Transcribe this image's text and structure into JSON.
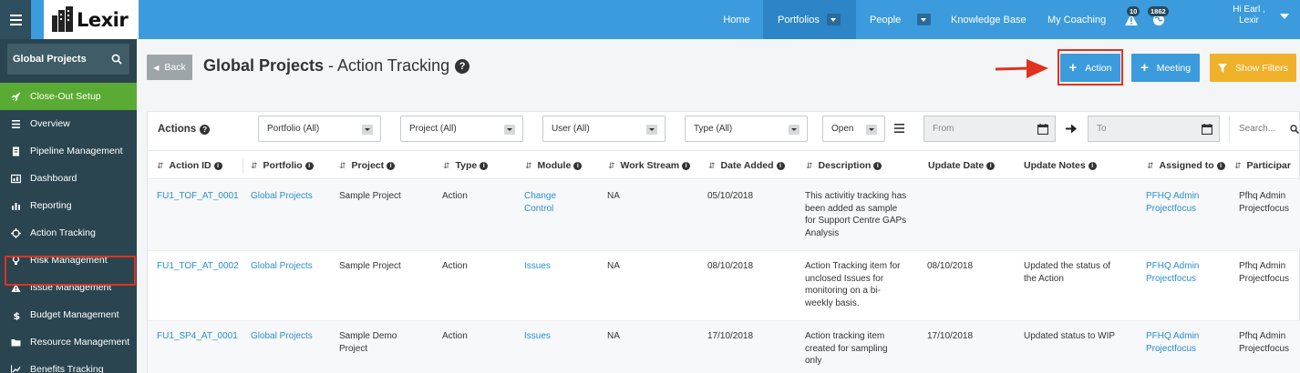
{
  "topnav": {
    "logo_text": "Lexir",
    "items": [
      {
        "label": "Home"
      },
      {
        "label": "Portfolios"
      },
      {
        "label": "People"
      },
      {
        "label": "Knowledge Base"
      },
      {
        "label": "My Coaching"
      }
    ],
    "alerts_count": "10",
    "notifications_count": "1862",
    "user_greeting": "Hi Earl ,",
    "user_name": "Lexir",
    "bar_color": "#3c9bdc"
  },
  "sidebar": {
    "search_label": "Global Projects",
    "items": [
      {
        "label": "Close-Out Setup",
        "icon": "rocket-icon"
      },
      {
        "label": "Overview",
        "icon": "list-icon"
      },
      {
        "label": "Pipeline Management",
        "icon": "document-icon"
      },
      {
        "label": "Dashboard",
        "icon": "dashboard-icon"
      },
      {
        "label": "Reporting",
        "icon": "bar-chart-icon"
      },
      {
        "label": "Action Tracking",
        "icon": "crosshair-icon"
      },
      {
        "label": "Risk Management",
        "icon": "lightbulb-icon"
      },
      {
        "label": "Issue Management",
        "icon": "warning-icon"
      },
      {
        "label": "Budget Management",
        "icon": "dollar-icon"
      },
      {
        "label": "Resource Management",
        "icon": "folder-icon"
      },
      {
        "label": "Benefits Tracking",
        "icon": "line-chart-icon"
      }
    ]
  },
  "header": {
    "back_label": "Back",
    "title_bold": "Global Projects",
    "title_rest": " - Action Tracking",
    "buttons": {
      "action": "Action",
      "meeting": "Meeting",
      "show_filters": "Show Filters"
    }
  },
  "panel": {
    "title": "Actions",
    "filters": {
      "portfolio": "Portfolio (All)",
      "project": "Project (All)",
      "user": "User (All)",
      "type": "Type (All)",
      "status": "Open",
      "from_placeholder": "From",
      "to_placeholder": "To",
      "search_placeholder": "Search..."
    },
    "columns": [
      "Action ID",
      "Portfolio",
      "Project",
      "Type",
      "Module",
      "Work Stream",
      "Date Added",
      "Description",
      "Update Date",
      "Update Notes",
      "Assigned to",
      "Participar"
    ],
    "rows": [
      {
        "action_id": "FU1_TOF_AT_0001",
        "portfolio": "Global Projects",
        "project": [
          "Sample Project"
        ],
        "type": "Action",
        "module": [
          "Change",
          "Control"
        ],
        "work_stream": "NA",
        "date_added": "05/10/2018",
        "description": [
          "This activitiy tracking has",
          "been added as sample",
          "for Support Centre GAPs",
          "Analysis"
        ],
        "update_date": "",
        "update_notes": [],
        "assigned_to": [
          "PFHQ Admin",
          "Projectfocus"
        ],
        "participants": [
          "Pfhq Admin",
          "Projectfocus"
        ]
      },
      {
        "action_id": "FU1_TOF_AT_0002",
        "portfolio": "Global Projects",
        "project": [
          "Sample Project"
        ],
        "type": "Action",
        "module": [
          "Issues"
        ],
        "work_stream": "NA",
        "date_added": "08/10/2018",
        "description": [
          "Action Tracking item for",
          "unclosed Issues for",
          "monitoring on a bi-",
          "weekly basis."
        ],
        "update_date": "08/10/2018",
        "update_notes": [
          "Updated the status of",
          "the Action"
        ],
        "assigned_to": [
          "PFHQ Admin",
          "Projectfocus"
        ],
        "participants": [
          "Pfhq Admin",
          "Projectfocus"
        ]
      },
      {
        "action_id": "FU1_SP4_AT_0001",
        "portfolio": "Global Projects",
        "project": [
          "Sample Demo",
          "Project"
        ],
        "type": "Action",
        "module": [
          "Issues"
        ],
        "work_stream": "NA",
        "date_added": "17/10/2018",
        "description": [
          "Action tracking item",
          "created for sampling",
          "only"
        ],
        "update_date": "17/10/2018",
        "update_notes": [
          "Updated status to WIP"
        ],
        "assigned_to": [
          "PFHQ Admin",
          "Projectfocus"
        ],
        "participants": [
          "Pfhq Admin",
          "Projectfocus"
        ]
      }
    ]
  },
  "colors": {
    "sidebar_bg": "#2a4550",
    "accent_green": "#5aab33",
    "button_blue": "#3c9bdc",
    "button_orange": "#f0b12a",
    "link_blue": "#2a8fd0",
    "annotation_red": "#e0321f"
  }
}
